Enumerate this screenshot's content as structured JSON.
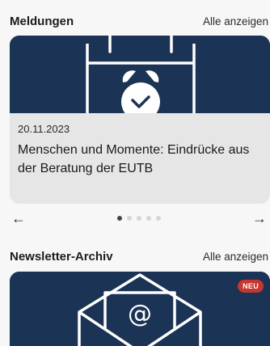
{
  "meldungen": {
    "title": "Meldungen",
    "show_all_label": "Alle anzeigen",
    "card": {
      "date": "20.11.2023",
      "title": "Menschen und Momente: Eindrücke aus der Beratung der EUTB",
      "image_icon": "alarm-clock-calendar-icon"
    },
    "pager": {
      "prev_icon": "arrow-left-icon",
      "next_icon": "arrow-right-icon",
      "dot_count": 5,
      "active_index": 0
    }
  },
  "newsletter": {
    "title": "Newsletter-Archiv",
    "show_all_label": "Alle anzeigen",
    "card": {
      "badge": "NEU",
      "image_icon": "email-envelope-icon"
    }
  },
  "colors": {
    "card_image_bg": "#1b3354",
    "card_bg": "#e6e6e6",
    "badge_bg": "#c8362f"
  }
}
